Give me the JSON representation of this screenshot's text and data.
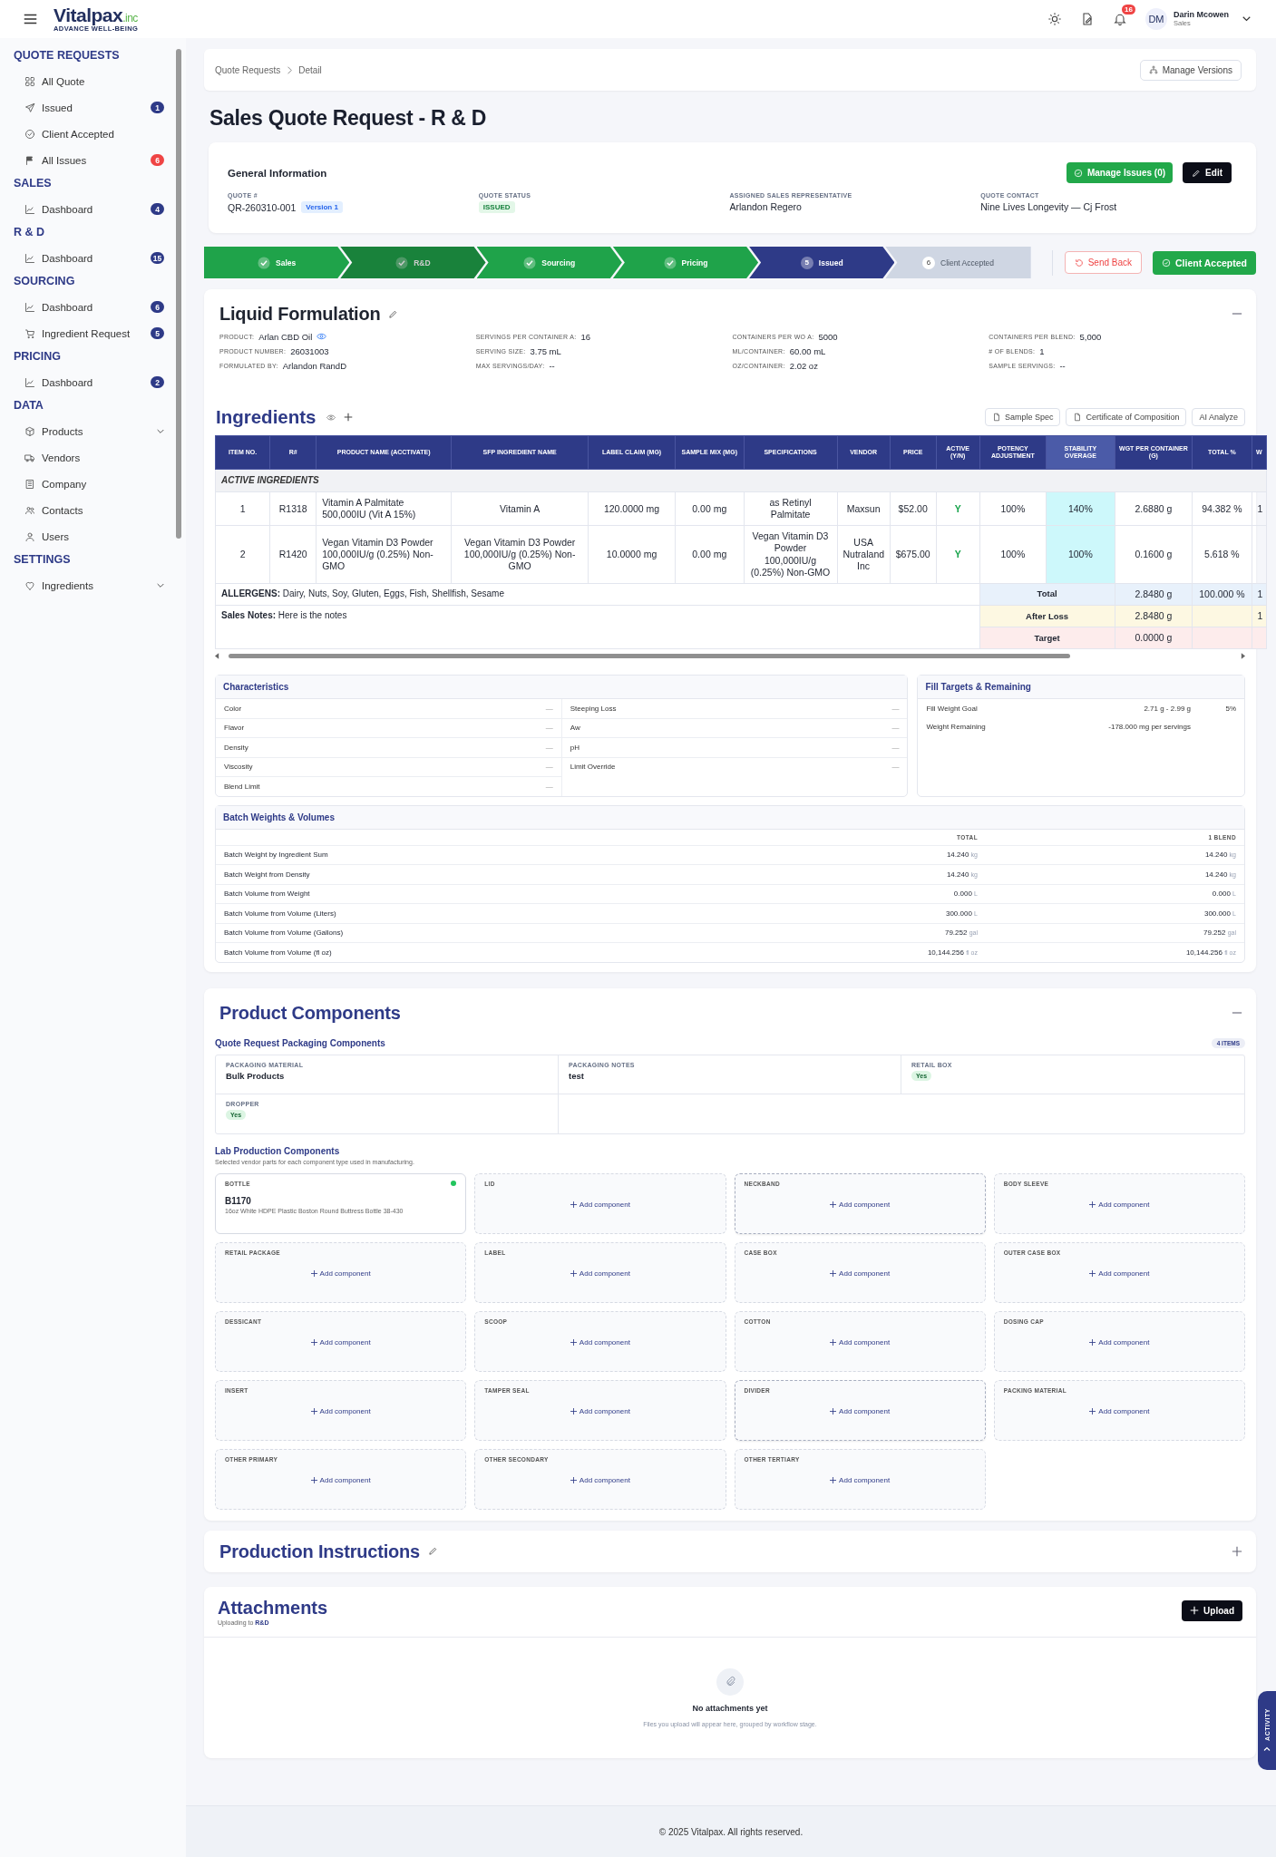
{
  "header": {
    "logo": "Vitalpax",
    "logo_suffix": ".inc",
    "tagline": "ADVANCE WELL-BEING",
    "notifications": "16",
    "user": {
      "initials": "DM",
      "name": "Darin Mcowen",
      "role": "Sales"
    }
  },
  "sidebar": {
    "sections": [
      {
        "title": "QUOTE REQUESTS",
        "items": [
          {
            "label": "All Quote"
          },
          {
            "label": "Issued",
            "badge": "1",
            "color": "#2e3a87"
          },
          {
            "label": "Client Accepted"
          },
          {
            "label": "All Issues",
            "badge": "6",
            "color": "#ef4444"
          }
        ]
      },
      {
        "title": "SALES",
        "items": [
          {
            "label": "Dashboard",
            "badge": "4",
            "color": "#2e3a87"
          }
        ]
      },
      {
        "title": "R & D",
        "items": [
          {
            "label": "Dashboard",
            "badge": "15",
            "color": "#2e3a87"
          }
        ]
      },
      {
        "title": "SOURCING",
        "items": [
          {
            "label": "Dashboard",
            "badge": "6",
            "color": "#2e3a87"
          },
          {
            "label": "Ingredient Request",
            "badge": "5",
            "color": "#2e3a87"
          }
        ]
      },
      {
        "title": "PRICING",
        "items": [
          {
            "label": "Dashboard",
            "badge": "2",
            "color": "#2e3a87"
          }
        ]
      },
      {
        "title": "DATA",
        "items": [
          {
            "label": "Products",
            "expanded": false
          },
          {
            "label": "Vendors"
          },
          {
            "label": "Company"
          },
          {
            "label": "Contacts"
          },
          {
            "label": "Users"
          }
        ]
      },
      {
        "title": "SETTINGS",
        "items": [
          {
            "label": "Ingredients",
            "expanded": false
          }
        ]
      }
    ]
  },
  "breadcrumb": [
    "Quote Requests",
    "Detail"
  ],
  "manage_versions": "Manage Versions",
  "title": "Sales Quote Request - R & D",
  "general": {
    "title": "General Information",
    "manage_issues": "Manage Issues (0)",
    "edit": "Edit",
    "fields": [
      {
        "label": "QUOTE #",
        "value": "QR-260310-001",
        "tag": "Version 1",
        "kind": "text"
      },
      {
        "label": "QUOTE STATUS",
        "value": "ISSUED",
        "kind": "status"
      },
      {
        "label": "ASSIGNED SALES REPRESENTATIVE",
        "value": "Arlandon Regero",
        "kind": "text"
      },
      {
        "label": "QUOTE CONTACT",
        "value": "Nine Lives Longevity — Cj Frost",
        "kind": "text"
      }
    ]
  },
  "stages": [
    {
      "label": "Sales",
      "completed": true,
      "current": false,
      "selected": false
    },
    {
      "label": "R&D",
      "completed": true,
      "current": false,
      "selected": true
    },
    {
      "label": "Sourcing",
      "completed": true,
      "current": false,
      "selected": false
    },
    {
      "label": "Pricing",
      "completed": true,
      "current": false,
      "selected": false
    },
    {
      "number": "5",
      "label": "Issued",
      "completed": false,
      "current": true,
      "selected": false
    },
    {
      "number": "6",
      "label": "Client Accepted",
      "completed": false,
      "current": false,
      "selected": false
    }
  ],
  "stage_actions": {
    "send_back": "Send Back",
    "accept": "Client Accepted"
  },
  "formulation": {
    "title": "Liquid Formulation",
    "expanded": true,
    "meta": [
      [
        {
          "label": "PRODUCT:",
          "value": "Arlan CBD Oil"
        },
        {
          "label": "PRODUCT NUMBER:",
          "value": "26031003"
        },
        {
          "label": "FORMULATED BY:",
          "value": "Arlandon RandD"
        }
      ],
      [
        {
          "label": "SERVINGS PER CONTAINER A:",
          "value": "16"
        },
        {
          "label": "SERVING SIZE:",
          "value": "3.75 mL"
        },
        {
          "label": "MAX SERVINGS/DAY:",
          "value": "--"
        }
      ],
      [
        {
          "label": "CONTAINERS PER WO A:",
          "value": "5000"
        },
        {
          "label": "ML/CONTAINER:",
          "value": "60.00 mL"
        },
        {
          "label": "OZ/CONTAINER:",
          "value": "2.02 oz"
        }
      ],
      [
        {
          "label": "CONTAINERS PER BLEND:",
          "value": "5,000"
        },
        {
          "label": "# OF BLENDS:",
          "value": "1"
        },
        {
          "label": "SAMPLE SERVINGS:",
          "value": "--"
        }
      ]
    ]
  },
  "ingredients": {
    "title": "Ingredients",
    "tools": [
      {
        "label": "Sample Spec",
        "kind": "document"
      },
      {
        "label": "Certificate of Composition",
        "kind": "document"
      },
      {
        "label": "AI Analyze",
        "kind": "plain"
      }
    ],
    "columns": [
      {
        "label": "ITEM NO.",
        "kind": "text",
        "highlighted": false
      },
      {
        "label": "R#",
        "kind": "text",
        "highlighted": false
      },
      {
        "label": "PRODUCT NAME (ACCTIVATE)",
        "kind": "left",
        "highlighted": false
      },
      {
        "label": "SFP INGREDIENT NAME",
        "kind": "text",
        "highlighted": false
      },
      {
        "label": "LABEL CLAIM (MG)",
        "kind": "text",
        "highlighted": false
      },
      {
        "label": "SAMPLE MIX (MG)",
        "kind": "text",
        "highlighted": false
      },
      {
        "label": "SPECIFICATIONS",
        "kind": "text",
        "highlighted": false
      },
      {
        "label": "VENDOR",
        "kind": "text",
        "highlighted": false
      },
      {
        "label": "PRICE",
        "kind": "text",
        "highlighted": false
      },
      {
        "label": "ACTIVE (Y/N)",
        "kind": "flag",
        "highlighted": false
      },
      {
        "label": "POTENCY ADJUSTMENT",
        "kind": "text",
        "highlighted": false
      },
      {
        "label": "STABILITY OVERAGE",
        "kind": "text",
        "highlighted": true
      },
      {
        "label": "WGT PER CONTAINER (G)",
        "kind": "text",
        "highlighted": false
      },
      {
        "label": "TOTAL %",
        "kind": "text",
        "highlighted": false
      },
      {
        "label": "W",
        "kind": "text",
        "highlighted": false
      }
    ],
    "group": "ACTIVE INGREDIENTS",
    "rows": [
      [
        "1",
        "R1318",
        "Vitamin A Palmitate 500,000IU (Vit A 15%)",
        "Vitamin A",
        "120.0000 mg",
        "0.00 mg",
        "as Retinyl Palmitate",
        "Maxsun",
        "$52.00",
        "Y",
        "100%",
        "140%",
        "2.6880 g",
        "94.382 %",
        "1"
      ],
      [
        "2",
        "R1420",
        "Vegan Vitamin D3 Powder 100,000IU/g (0.25%) Non-GMO",
        "Vegan Vitamin D3 Powder 100,000IU/g (0.25%) Non-GMO",
        "10.0000 mg",
        "0.00 mg",
        "Vegan Vitamin D3 Powder 100,000IU/g (0.25%) Non-GMO",
        "USA Nutraland Inc",
        "$675.00",
        "Y",
        "100%",
        "100%",
        "0.1600 g",
        "5.618 %"
      ]
    ],
    "allergens": {
      "label": "ALLERGENS:",
      "value": "Dairy, Nuts, Soy, Gluten, Eggs, Fish, Shellfish, Sesame"
    },
    "sales_notes": {
      "label": "Sales Notes:",
      "value": "Here is the notes"
    },
    "summary": [
      {
        "kind": "total",
        "label": "Total",
        "weight": "2.8480 g",
        "percent": "100.000 %",
        "column_15": "1"
      },
      {
        "kind": "after_loss",
        "label": "After Loss",
        "weight": "2.8480 g",
        "column_15": "1"
      },
      {
        "kind": "target",
        "label": "Target",
        "weight": "0.0000 g"
      }
    ]
  },
  "characteristics": {
    "title": "Characteristics",
    "left": [
      {
        "label": "Color",
        "value": "—"
      },
      {
        "label": "Flavor",
        "value": "—"
      },
      {
        "label": "Density",
        "value": "—"
      },
      {
        "label": "Viscosity",
        "value": "—"
      },
      {
        "label": "Blend Limit",
        "value": "—"
      }
    ],
    "right": [
      {
        "label": "Steeping Loss",
        "value": "—"
      },
      {
        "label": "Aw",
        "value": "—"
      },
      {
        "label": "pH",
        "value": "—"
      },
      {
        "label": "Limit Override",
        "value": "—"
      }
    ]
  },
  "fill_targets": {
    "title": "Fill Targets & Remaining",
    "rows": [
      {
        "label": "Fill Weight Goal",
        "value": "2.71 g - 2.99 g",
        "extra": "5%"
      },
      {
        "label": "Weight Remaining",
        "value": "-178.000 mg per servings"
      }
    ]
  },
  "batch": {
    "title": "Batch Weights & Volumes",
    "columns": [
      "TOTAL",
      "1 BLEND"
    ],
    "rows": [
      {
        "label": "Batch Weight by Ingredient Sum",
        "total": "14.240",
        "total_unit": "kg",
        "blend": "14.240",
        "blend_unit": "kg"
      },
      {
        "label": "Batch Weight from Density",
        "total": "14.240",
        "total_unit": "kg",
        "blend": "14.240",
        "blend_unit": "kg"
      },
      {
        "label": "Batch Volume from Weight",
        "total": "0.000",
        "total_unit": "L",
        "blend": "0.000",
        "blend_unit": "L"
      },
      {
        "label": "Batch Volume from Volume (Liters)",
        "total": "300.000",
        "total_unit": "L",
        "blend": "300.000",
        "blend_unit": "L"
      },
      {
        "label": "Batch Volume from Volume (Gallons)",
        "total": "79.252",
        "total_unit": "gal",
        "blend": "79.252",
        "blend_unit": "gal"
      },
      {
        "label": "Batch Volume from Volume (fl oz)",
        "total": "10,144.256",
        "total_unit": "fl oz",
        "blend": "10,144.256",
        "blend_unit": "fl oz"
      }
    ]
  },
  "components": {
    "title": "Product Components",
    "expanded": true,
    "packaging_title": "Quote Request Packaging Components",
    "count": "4 ITEMS",
    "packaging": [
      {
        "label": "PACKAGING MATERIAL",
        "value": "Bulk Products",
        "kind": "text"
      },
      {
        "label": "PACKAGING NOTES",
        "value": "test",
        "kind": "text"
      },
      {
        "label": "RETAIL BOX",
        "value": "Yes",
        "kind": "badge"
      },
      {
        "label": "DROPPER",
        "value": "Yes",
        "kind": "badge"
      }
    ],
    "lab_title": "Lab Production Components",
    "lab_subtitle": "Selected vendor parts for each component type used in manufacturing.",
    "lab": [
      {
        "type": "BOTTLE",
        "part": "B1170",
        "description": "16oz White HDPE Plastic Boston Round Buttress Bottle 38-430",
        "color": "#22c55e",
        "highlighted": false
      },
      {
        "type": "LID",
        "action": "Add component",
        "highlighted": false
      },
      {
        "type": "NECKBAND",
        "action": "Add component",
        "highlighted": true
      },
      {
        "type": "BODY SLEEVE",
        "action": "Add component",
        "highlighted": false
      },
      {
        "type": "RETAIL PACKAGE",
        "action": "Add component",
        "highlighted": false
      },
      {
        "type": "LABEL",
        "action": "Add component",
        "highlighted": false
      },
      {
        "type": "CASE BOX",
        "action": "Add component",
        "highlighted": false
      },
      {
        "type": "OUTER CASE BOX",
        "action": "Add component",
        "highlighted": false
      },
      {
        "type": "DESSICANT",
        "action": "Add component",
        "highlighted": false
      },
      {
        "type": "SCOOP",
        "action": "Add component",
        "highlighted": false
      },
      {
        "type": "COTTON",
        "action": "Add component",
        "highlighted": false
      },
      {
        "type": "DOSING CAP",
        "action": "Add component",
        "highlighted": false
      },
      {
        "type": "INSERT",
        "action": "Add component",
        "highlighted": false
      },
      {
        "type": "TAMPER SEAL",
        "action": "Add component",
        "highlighted": false
      },
      {
        "type": "DIVIDER",
        "action": "Add component",
        "highlighted": true
      },
      {
        "type": "PACKING MATERIAL",
        "action": "Add component",
        "highlighted": false
      },
      {
        "type": "OTHER PRIMARY",
        "action": "Add component",
        "highlighted": false
      },
      {
        "type": "OTHER SECONDARY",
        "action": "Add component",
        "highlighted": false
      },
      {
        "type": "OTHER TERTIARY",
        "action": "Add component",
        "highlighted": false
      }
    ]
  },
  "instructions": {
    "title": "Production Instructions",
    "expanded": false
  },
  "attachments": {
    "title": "Attachments",
    "subtitle": "Uploading to **R&D**",
    "upload": "Upload",
    "empty_title": "No attachments yet",
    "empty_text": "Files you upload will appear here, grouped by workflow stage."
  },
  "activity": "ACTIVITY",
  "footer": "© 2025 Vitalpax. All rights reserved."
}
